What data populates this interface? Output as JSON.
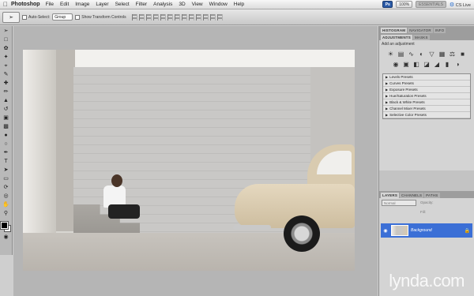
{
  "menubar": {
    "app_name": "Photoshop",
    "items": [
      "File",
      "Edit",
      "Image",
      "Layer",
      "Select",
      "Filter",
      "Analysis",
      "3D",
      "View",
      "Window",
      "Help"
    ],
    "ps_logo": "Ps",
    "zoom": "100%",
    "workspace": "ESSENTIALS",
    "cs_live": "CS Live"
  },
  "options": {
    "auto_select_label": "Auto-Select:",
    "auto_select_value": "Group",
    "show_transform_label": "Show Transform Controls"
  },
  "panels": {
    "top_tabs": [
      "HISTOGRAM",
      "NAVIGATOR",
      "INFO"
    ],
    "adj_tabs": [
      "ADJUSTMENTS",
      "MASKS"
    ],
    "add_adjustment": "Add an adjustment",
    "presets": [
      "Levels Presets",
      "Curves Presets",
      "Exposure Presets",
      "Hue/Saturation Presets",
      "Black & White Presets",
      "Channel Mixer Presets",
      "Selective Color Presets"
    ],
    "layer_tabs": [
      "LAYERS",
      "CHANNELS",
      "PATHS"
    ],
    "blend_mode": "Normal",
    "opacity_label": "Opacity:",
    "fill_label": "Fill:",
    "layer_name": "Background"
  },
  "watermark": {
    "brand": "lynda",
    "dot": ".",
    "tld": "com"
  }
}
